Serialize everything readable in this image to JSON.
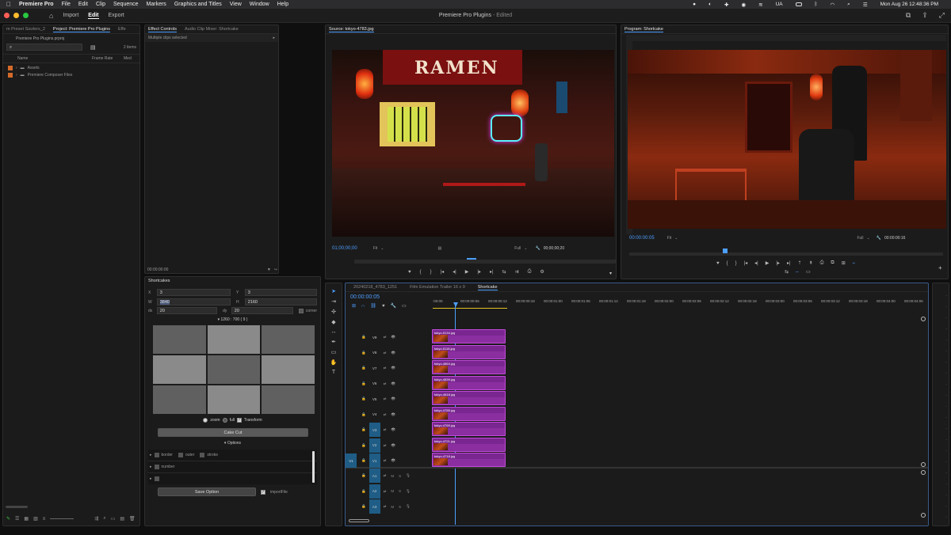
{
  "menubar": {
    "apple": "",
    "app": "Premiere Pro",
    "items": [
      "File",
      "Edit",
      "Clip",
      "Sequence",
      "Markers",
      "Graphics and Titles",
      "View",
      "Window",
      "Help"
    ],
    "status_ua": "UA",
    "datetime": "Mon Aug 26  12:48:36 PM"
  },
  "titlebar": {
    "tabs": [
      "Import",
      "Edit",
      "Export"
    ],
    "title": "Premiere Pro Plugins",
    "edited": " - Edited"
  },
  "project_panel": {
    "tabs": [
      "m Preset Sizzlers_2",
      "Project: Premiere Pro Plugins",
      "Effe"
    ],
    "file": "Premiere Pro Plugins.prproj",
    "count": "2 items",
    "columns": [
      "Name",
      "Frame Rate",
      "Med"
    ],
    "items": [
      "Assets",
      "Premiere Composer Files"
    ]
  },
  "effect_controls": {
    "tabs": [
      "Effect Controls",
      "Audio Clip Mixer: Shortcake"
    ],
    "message": "Multiple clips selected",
    "timecode": "00:00:00:00"
  },
  "source_monitor": {
    "tab": "Source: tokyo-4783.jpg",
    "sign": "RAMEN",
    "timecode_left": "01;00;00;00",
    "fit": "Fit",
    "quality": "Full",
    "timecode_right": "00;00;00;20"
  },
  "program_monitor": {
    "tab": "Program: Shortcake",
    "timecode_left": "00:00:00:05",
    "fit": "Fit",
    "quality": "Full",
    "timecode_right": "00:00:00:16"
  },
  "shortcakes": {
    "title": "Shortcakes",
    "x_label": "X",
    "x_value": "3",
    "y_label": "Y",
    "y_value": "3",
    "w_label": "W",
    "w_value": "3840",
    "h_label": "H",
    "h_value": "2160",
    "dx_label": "dx",
    "dx_value": "20",
    "dy_label": "dy",
    "dy_value": "20",
    "corner_label": "corner",
    "size_info": "▾ 1260 : 700 ( 9 )",
    "radio_zoom": "zoom",
    "radio_full": "full",
    "check_transform": "Transform",
    "cake_cut": "Cake Cut",
    "options_label": "▾ Options",
    "opt_border": "border",
    "opt_outer": "outer",
    "opt_stroke": "stroke",
    "opt_number": "number",
    "save_option": "Save Option",
    "import_file": "importFile"
  },
  "timeline": {
    "tabs": [
      "20240218_4783_1251",
      "Film Emulation Trailer 16 x 9",
      "Shortcake"
    ],
    "timecode": "00:00:00:05",
    "ruler": [
      ":00:00",
      "00:00:00:06",
      "00:00:00:12",
      "00:00:00:18",
      "00:00:01:00",
      "00:00:01:06",
      "00:00:01:12",
      "00:00:01:18",
      "00:00:02:00",
      "00:00:02:06",
      "00:00:02:12",
      "00:00:02:18",
      "00:00:03:00",
      "00:00:03:06",
      "00:00:03:12",
      "00:00:03:18",
      "00:00:04:00",
      "00:00:04:06"
    ],
    "video_tracks": [
      "V9",
      "V8",
      "V7",
      "V6",
      "V5",
      "V4",
      "V3",
      "V2",
      "V1"
    ],
    "audio_tracks": [
      "A1",
      "A2",
      "A3"
    ],
    "clips": [
      "tokyo-5134.jpg",
      "tokyo-5118.jpg",
      "tokyo-4864.jpg",
      "tokyo-4839.jpg",
      "tokyo-4818.jpg",
      "tokyo-4785.jpg",
      "tokyo-4769.jpg",
      "tokyo-4721.jpg",
      "tokyo-4718.jpg"
    ],
    "source_patch": "V1",
    "audio_m": "M",
    "audio_s": "S"
  },
  "colors": {
    "accent": "#4d9eff",
    "clip": "#8a2ea0",
    "track_target": "#1f5d86",
    "playhead": "#4d9eff"
  }
}
